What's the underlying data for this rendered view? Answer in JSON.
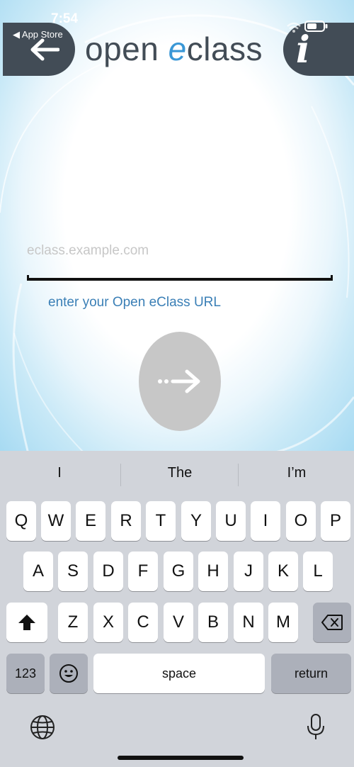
{
  "status_bar": {
    "time": "7:54",
    "back_label": "◀ App Store"
  },
  "header": {
    "title_part1": "open ",
    "title_accent": "e",
    "title_part2": "class",
    "info_label": "i"
  },
  "form": {
    "url_placeholder": "eclass.example.com",
    "url_value": "",
    "hint": "enter your Open eClass URL"
  },
  "keyboard": {
    "suggestions": [
      "I",
      "The",
      "I’m"
    ],
    "row1": [
      "Q",
      "W",
      "E",
      "R",
      "T",
      "Y",
      "U",
      "I",
      "O",
      "P"
    ],
    "row2": [
      "A",
      "S",
      "D",
      "F",
      "G",
      "H",
      "J",
      "K",
      "L"
    ],
    "row3": [
      "Z",
      "X",
      "C",
      "V",
      "B",
      "N",
      "M"
    ],
    "numbers_label": "123",
    "space_label": "space",
    "return_label": "return"
  },
  "colors": {
    "header_dark": "#424c56",
    "accent_blue": "#3a97d6",
    "hint_blue": "#3a7fb6",
    "go_button_gray": "#c7c7c7",
    "keyboard_bg": "#d1d4da"
  }
}
